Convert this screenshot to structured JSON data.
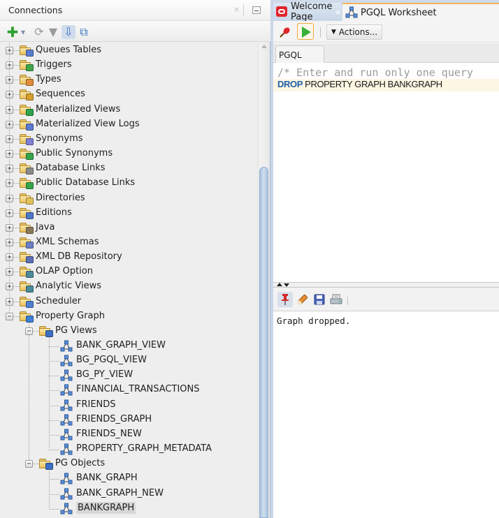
{
  "connections_panel": {
    "title": "Connections",
    "close_icon": "×",
    "toolbar": [
      {
        "name": "add-connection",
        "icon": "plus-icon",
        "glyph": "✚",
        "color": "#2fa12f"
      },
      {
        "name": "add-dropdown",
        "icon": "chevron-down-icon",
        "glyph": "▾",
        "color": "#7a8ea6"
      },
      {
        "name": "refresh",
        "icon": "refresh-icon",
        "glyph": "⟳",
        "color": "#9a9a9a"
      },
      {
        "name": "filter",
        "icon": "filter-icon",
        "glyph": "▼",
        "color": "#9a9a9a"
      },
      {
        "name": "schema-browser",
        "icon": "schema-browser-icon",
        "glyph": "⇩",
        "color": "#3b74c4"
      },
      {
        "name": "collapse-all",
        "icon": "collapse-all-icon",
        "glyph": "⧉",
        "color": "#3b74c4"
      }
    ],
    "tree": [
      {
        "label": "Queues Tables",
        "level": 1,
        "expander": "+",
        "icon": "queue-tables-folder-icon",
        "badge": "#5a7bd1"
      },
      {
        "label": "Triggers",
        "level": 1,
        "expander": "+",
        "icon": "triggers-folder-icon",
        "badge": "#3fa64a"
      },
      {
        "label": "Types",
        "level": 1,
        "expander": "+",
        "icon": "types-folder-icon",
        "badge": "#e08b3a"
      },
      {
        "label": "Sequences",
        "level": 1,
        "expander": "+",
        "icon": "sequences-folder-icon",
        "badge": "#d6a030"
      },
      {
        "label": "Materialized Views",
        "level": 1,
        "expander": "+",
        "icon": "materialized-views-folder-icon",
        "badge": "#2da34b"
      },
      {
        "label": "Materialized View Logs",
        "level": 1,
        "expander": "+",
        "icon": "materialized-view-logs-folder-icon",
        "badge": "#5a7bd1"
      },
      {
        "label": "Synonyms",
        "level": 1,
        "expander": "+",
        "icon": "synonyms-folder-icon",
        "badge": "#7f7fd6"
      },
      {
        "label": "Public Synonyms",
        "level": 1,
        "expander": "+",
        "icon": "public-synonyms-folder-icon",
        "badge": "#35a54a"
      },
      {
        "label": "Database Links",
        "level": 1,
        "expander": "+",
        "icon": "database-links-folder-icon",
        "badge": "#8a8a8a"
      },
      {
        "label": "Public Database Links",
        "level": 1,
        "expander": "+",
        "icon": "public-database-links-folder-icon",
        "badge": "#35a54a"
      },
      {
        "label": "Directories",
        "level": 1,
        "expander": "+",
        "icon": "directories-folder-icon",
        "badge": "#e3c05a"
      },
      {
        "label": "Editions",
        "level": 1,
        "expander": "+",
        "icon": "editions-folder-icon",
        "badge": "#4d78c9"
      },
      {
        "label": "Java",
        "level": 1,
        "expander": "+",
        "icon": "java-folder-icon",
        "badge": "#8a7a5a"
      },
      {
        "label": "XML Schemas",
        "level": 1,
        "expander": "+",
        "icon": "xml-schemas-folder-icon",
        "badge": "#6a7fc8"
      },
      {
        "label": "XML DB Repository",
        "level": 1,
        "expander": "+",
        "icon": "xml-db-repository-folder-icon",
        "badge": "#5a6fb8"
      },
      {
        "label": "OLAP Option",
        "level": 1,
        "expander": "+",
        "icon": "olap-option-folder-icon",
        "badge": "#4a8a9a"
      },
      {
        "label": "Analytic Views",
        "level": 1,
        "expander": "+",
        "icon": "analytic-views-folder-icon",
        "badge": "#4a8a9a"
      },
      {
        "label": "Scheduler",
        "level": 1,
        "expander": "+",
        "icon": "scheduler-folder-icon",
        "badge": "#4d7fd0"
      },
      {
        "label": "Property Graph",
        "level": 1,
        "expander": "-",
        "icon": "property-graph-folder-icon",
        "badge": "#3d7fd6"
      },
      {
        "label": "PG Views",
        "level": 2,
        "expander": "-",
        "icon": "pg-views-folder-icon",
        "badge": "#3b6fc4"
      },
      {
        "label": "BANK_GRAPH_VIEW",
        "level": 3,
        "icon": "graph-icon"
      },
      {
        "label": "BG_PGQL_VIEW",
        "level": 3,
        "icon": "graph-icon"
      },
      {
        "label": "BG_PY_VIEW",
        "level": 3,
        "icon": "graph-icon"
      },
      {
        "label": "FINANCIAL_TRANSACTIONS",
        "level": 3,
        "icon": "graph-icon"
      },
      {
        "label": "FRIENDS",
        "level": 3,
        "icon": "graph-icon"
      },
      {
        "label": "FRIENDS_GRAPH",
        "level": 3,
        "icon": "graph-icon"
      },
      {
        "label": "FRIENDS_NEW",
        "level": 3,
        "icon": "graph-icon"
      },
      {
        "label": "PROPERTY_GRAPH_METADATA",
        "level": 3,
        "icon": "graph-icon"
      },
      {
        "label": "PG Objects",
        "level": 2,
        "expander": "-",
        "icon": "pg-objects-folder-icon",
        "badge": "#3b6fc4"
      },
      {
        "label": "BANK_GRAPH",
        "level": 3,
        "icon": "graph-icon"
      },
      {
        "label": "BANK_GRAPH_NEW",
        "level": 3,
        "icon": "graph-icon"
      },
      {
        "label": "BANKGRAPH",
        "level": 3,
        "icon": "graph-icon",
        "selected": true
      }
    ]
  },
  "editor": {
    "tabs": [
      {
        "label": "Welcome Page",
        "icon": "oracle-logo-icon",
        "close": "×",
        "active": false
      },
      {
        "label": "PGQL Worksheet",
        "icon": "graph-icon",
        "active": true
      }
    ],
    "toolbar": {
      "actions_label": "Actions..."
    },
    "subtab": "PGQL",
    "lines": {
      "comment": "/* Enter and run only one query",
      "keyword": "DROP",
      "statement_rest": " PROPERTY GRAPH BANKGRAPH"
    },
    "output_toolbar": [
      {
        "name": "pin",
        "icon": "pin-icon"
      },
      {
        "name": "clear",
        "icon": "eraser-icon"
      },
      {
        "name": "save",
        "icon": "save-icon"
      },
      {
        "name": "print",
        "icon": "print-icon"
      }
    ],
    "output_text": "Graph dropped."
  },
  "colors": {
    "accent_tab": "#f0b55a",
    "run_green": "#36b23a",
    "keyword_blue": "#1f5fa8",
    "selection": "#d7d7d7"
  }
}
